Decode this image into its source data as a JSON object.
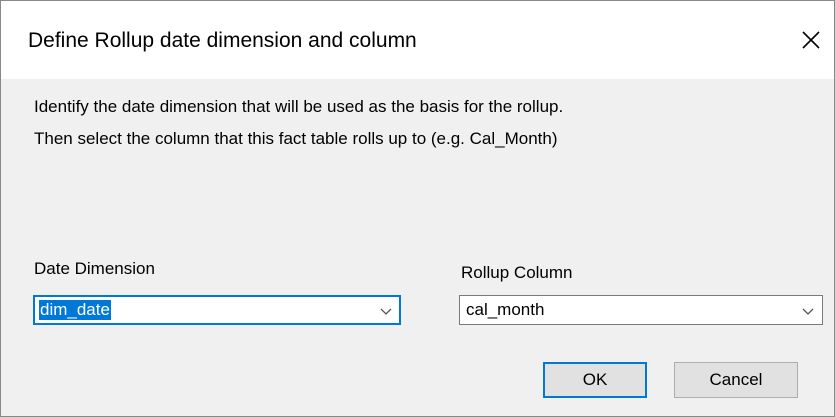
{
  "dialog": {
    "title": "Define Rollup date dimension and column",
    "close_icon": "close-icon"
  },
  "instructions": {
    "line1": "Identify the date dimension that will be used as the basis for the rollup.",
    "line2": "Then select the column that this fact table rolls up to (e.g. Cal_Month)"
  },
  "date_dimension": {
    "label": "Date Dimension",
    "value": "dim_date"
  },
  "rollup_column": {
    "label": "Rollup Column",
    "value": "cal_month"
  },
  "buttons": {
    "ok": "OK",
    "cancel": "Cancel"
  },
  "colors": {
    "focus": "#0078d7",
    "title_bg": "#ffffff",
    "dialog_bg": "#f0f0f0"
  }
}
